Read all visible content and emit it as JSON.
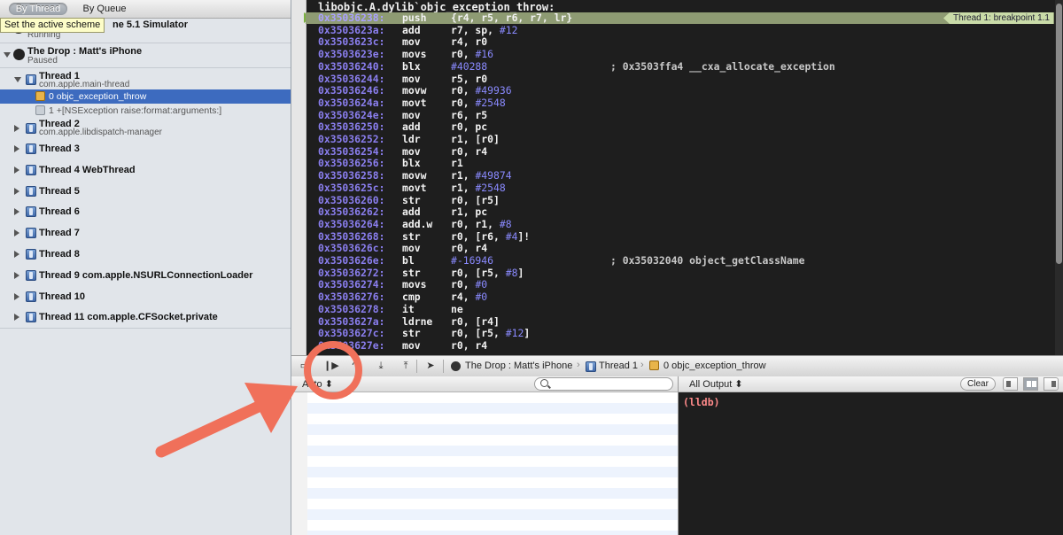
{
  "navigator": {
    "tabs": [
      "By Thread",
      "By Queue"
    ],
    "tooltip": "Set the active scheme",
    "processes": [
      {
        "name": "ne 5.1 Simulator",
        "status": "Running"
      },
      {
        "name": "The Drop : Matt's iPhone",
        "status": "Paused"
      }
    ],
    "thread1": {
      "title": "Thread 1",
      "queue": "com.apple.main-thread",
      "frames": [
        "0 objc_exception_throw",
        "1 +[NSException raise:format:arguments:]"
      ]
    },
    "thread2": {
      "title": "Thread 2",
      "queue": "com.apple.libdispatch-manager"
    },
    "threads": [
      "Thread 3",
      "Thread 4 WebThread",
      "Thread 5",
      "Thread 6",
      "Thread 7",
      "Thread 8",
      "Thread 9 com.apple.NSURLConnectionLoader",
      "Thread 10",
      "Thread 11 com.apple.CFSocket.private"
    ]
  },
  "disassembly": {
    "title": "libobjc.A.dylib`objc_exception_throw:",
    "breakpoint_badge": "Thread 1: breakpoint 1.1",
    "lines": [
      {
        "addr": "0x35036238:",
        "mnemonic": "push",
        "operands": "{r4, r5, r6, r7, lr}"
      },
      {
        "addr": "0x3503623a:",
        "mnemonic": "add",
        "operands": "r7, sp, ",
        "num": "#12"
      },
      {
        "addr": "0x3503623c:",
        "mnemonic": "mov",
        "operands": "r4, r0"
      },
      {
        "addr": "0x3503623e:",
        "mnemonic": "movs",
        "operands": "r0, ",
        "num": "#16"
      },
      {
        "addr": "0x35036240:",
        "mnemonic": "blx",
        "operands": "",
        "num": "#40288",
        "comment": "; 0x3503ffa4 __cxa_allocate_exception"
      },
      {
        "addr": "0x35036244:",
        "mnemonic": "mov",
        "operands": "r5, r0"
      },
      {
        "addr": "0x35036246:",
        "mnemonic": "movw",
        "operands": "r0, ",
        "num": "#49936"
      },
      {
        "addr": "0x3503624a:",
        "mnemonic": "movt",
        "operands": "r0, ",
        "num": "#2548"
      },
      {
        "addr": "0x3503624e:",
        "mnemonic": "mov",
        "operands": "r6, r5"
      },
      {
        "addr": "0x35036250:",
        "mnemonic": "add",
        "operands": "r0, pc"
      },
      {
        "addr": "0x35036252:",
        "mnemonic": "ldr",
        "operands": "r1, [r0]"
      },
      {
        "addr": "0x35036254:",
        "mnemonic": "mov",
        "operands": "r0, r4"
      },
      {
        "addr": "0x35036256:",
        "mnemonic": "blx",
        "operands": "r1"
      },
      {
        "addr": "0x35036258:",
        "mnemonic": "movw",
        "operands": "r1, ",
        "num": "#49874"
      },
      {
        "addr": "0x3503625c:",
        "mnemonic": "movt",
        "operands": "r1, ",
        "num": "#2548"
      },
      {
        "addr": "0x35036260:",
        "mnemonic": "str",
        "operands": "r0, [r5]"
      },
      {
        "addr": "0x35036262:",
        "mnemonic": "add",
        "operands": "r1, pc"
      },
      {
        "addr": "0x35036264:",
        "mnemonic": "add.w",
        "operands": "r0, r1, ",
        "num": "#8"
      },
      {
        "addr": "0x35036268:",
        "mnemonic": "str",
        "operands": "r0, [r6, ",
        "num": "#4",
        "tail": "]!"
      },
      {
        "addr": "0x3503626c:",
        "mnemonic": "mov",
        "operands": "r0, r4"
      },
      {
        "addr": "0x3503626e:",
        "mnemonic": "bl",
        "operands": "",
        "num": "#-16946",
        "comment": "; 0x35032040 object_getClassName"
      },
      {
        "addr": "0x35036272:",
        "mnemonic": "str",
        "operands": "r0, [r5, ",
        "num": "#8",
        "tail": "]"
      },
      {
        "addr": "0x35036274:",
        "mnemonic": "movs",
        "operands": "r0, ",
        "num": "#0"
      },
      {
        "addr": "0x35036276:",
        "mnemonic": "cmp",
        "operands": "r4, ",
        "num": "#0"
      },
      {
        "addr": "0x35036278:",
        "mnemonic": "it",
        "operands": "ne"
      },
      {
        "addr": "0x3503627a:",
        "mnemonic": "ldrne",
        "operands": "r0, [r4]"
      },
      {
        "addr": "0x3503627c:",
        "mnemonic": "str",
        "operands": "r0, [r5, ",
        "num": "#12",
        "tail": "]"
      },
      {
        "addr": "0x3503627e:",
        "mnemonic": "mov",
        "operands": "r0, r4"
      }
    ]
  },
  "debug_bar": {
    "process": "The Drop : Matt's iPhone",
    "thread": "Thread 1",
    "frame": "0 objc_exception_throw"
  },
  "variables": {
    "scope": "Auto",
    "search_placeholder": ""
  },
  "console": {
    "output_mode": "All Output",
    "clear_label": "Clear",
    "prompt": "(lldb)"
  },
  "colors": {
    "annotation": "#f0705a",
    "highlight_row": "#8e9b73",
    "selected_frame": "#3d6bbf",
    "address": "#8b7ff0",
    "lldb_prompt": "#ff8a8a"
  }
}
